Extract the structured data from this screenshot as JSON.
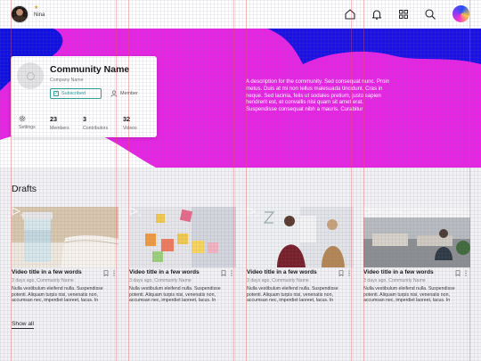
{
  "user": {
    "name": "Nina",
    "badge": "★"
  },
  "nav": {
    "icons": [
      "home-icon",
      "bell-icon",
      "grid-icon",
      "search-icon"
    ]
  },
  "community": {
    "name": "Community Name",
    "company": "Company Name",
    "subscribed_label": "Subscribed",
    "member_label": "Member",
    "stats": [
      {
        "value": "",
        "label": "Settings"
      },
      {
        "value": "23",
        "label": "Members"
      },
      {
        "value": "3",
        "label": "Contributors"
      },
      {
        "value": "32",
        "label": "Videos"
      }
    ],
    "description": "A description for the community. Sed consequat nunc. Proin metus. Duis at mi non tellus malesuada tincidunt. Cras in neque. Sed lacinia, felis ut sodales pretium, justo sapien hendrerit est, et convallis nisi quam sit amet erat. Suspendisse consequat nibh a mauris. Curabitur"
  },
  "drafts": {
    "title": "Drafts",
    "show_all": "Show all",
    "videos": [
      {
        "title": "Video title in a few words",
        "meta": "3 days ago, Community Name",
        "description": "Nulla vestibulum eleifend nulla. Suspendisse potenti. Aliquam turpis nisi, venenatis non, accumsan nec, imperdiet laoreet, lacus. In"
      },
      {
        "title": "Video title in a few words",
        "meta": "3 days ago, Community Name",
        "description": "Nulla vestibulum eleifend nulla. Suspendisse potenti. Aliquam turpis nisi, venenatis non, accumsan nec, imperdiet laoreet, lacus. In"
      },
      {
        "title": "Video title in a few words",
        "meta": "3 days ago, Community Name",
        "description": "Nulla vestibulum eleifend nulla. Suspendisse potenti. Aliquam turpis nisi, venenatis non, accumsan nec, imperdiet laoreet, lacus. In"
      },
      {
        "title": "Video title in a few words",
        "meta": "3 days ago, Community Name",
        "description": "Nulla vestibulum eleifend nulla. Suspendisse potenti. Aliquam turpis nisi, venenatis non, accumsan nec, imperdiet laoreet, lacus. In"
      }
    ]
  },
  "colors": {
    "accent": "#2aa39a",
    "hero_magenta": "#e826e8",
    "hero_blue": "#1010e6"
  }
}
